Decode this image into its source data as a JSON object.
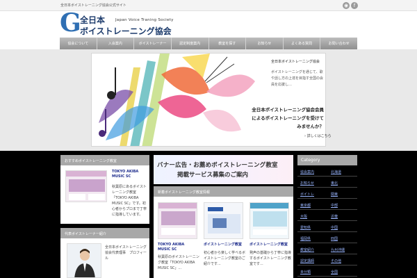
{
  "header": {
    "tagline": "全日本ボイストレーニング協会公式サイト",
    "logo_line1": "全日本",
    "logo_en": "Japan Voice Traning Society",
    "logo_line2": "ボイストレーニング協会",
    "social": [
      {
        "name": "rss-icon",
        "glyph": "◉"
      },
      {
        "name": "facebook-icon",
        "glyph": "f"
      }
    ]
  },
  "nav": {
    "items": [
      "協会について",
      "入会案内",
      "ボイストレーナー",
      "認定制度案内",
      "教室を探す",
      "お知らせ",
      "よくある質問",
      "お問い合わせ"
    ]
  },
  "hero": {
    "side_title": "全日本ボイストレーニング協会",
    "side_body": "ボイストレーニングを通じて、歌や話し方の上達を目指す全国の会員を応援し…",
    "caption": [
      "全日本ボイストレーニング協会会員",
      "によるボイストレーニングを受けて",
      "みませんか？"
    ],
    "more_label": "› 詳しくはこちら"
  },
  "left_column": {
    "widget1_title": "おすすめボイストレーニング教室",
    "school_title": "TOKYO AKIBA MUSIC SC",
    "school_desc": "秋葉原にあるボイストレーニング教室「TOKYO AKIBA MUSIC SC」です。初心者からプロまで丁寧に指導しています。",
    "widget2_title": "代表ボイストレーナー紹介",
    "profile_text": "全日本ボイストレーニング協会代表理事　プロフィール"
  },
  "center": {
    "banner_line1": "バナー広告・お薦めボイストレーニング教室",
    "banner_line2": "掲載サービス募集のご案内",
    "section_title": "新着ボイストレーニング教室情報",
    "posts": [
      {
        "title": "TOKYO AKIBA MUSIC SC",
        "excerpt": "秋葉原のボイストレーニング教室「TOKYO AKIBA MUSIC SC」..."
      },
      {
        "title": "ボイストレーニング教室",
        "excerpt": "初心者から楽しく学べるボイストレーニング教室のご紹介です..."
      },
      {
        "title": "ボイストレーニング教室",
        "excerpt": "発声の基礎から丁寧に指導するボイストレーニング教室です..."
      }
    ]
  },
  "sidebar": {
    "category_title": "Category",
    "rows": [
      [
        "協会案内",
        "北海道"
      ],
      [
        "お知らせ",
        "東北"
      ],
      [
        "ボイトレ",
        "関東"
      ],
      [
        "東京都",
        "中部"
      ],
      [
        "大阪",
        "近畿"
      ],
      [
        "愛知県",
        "中国"
      ],
      [
        "福岡県",
        "四国"
      ],
      [
        "教室紹介",
        "九州沖縄"
      ],
      [
        "認定講師",
        "その他"
      ],
      [
        "未分類",
        "全国"
      ]
    ]
  },
  "colors": {
    "nav_bg": "#a5a5a5",
    "dark_band": "#000000",
    "widget_head": "#a8a8a8",
    "link": "#1b2a8b",
    "logo_blue": "#1b3a6b"
  }
}
